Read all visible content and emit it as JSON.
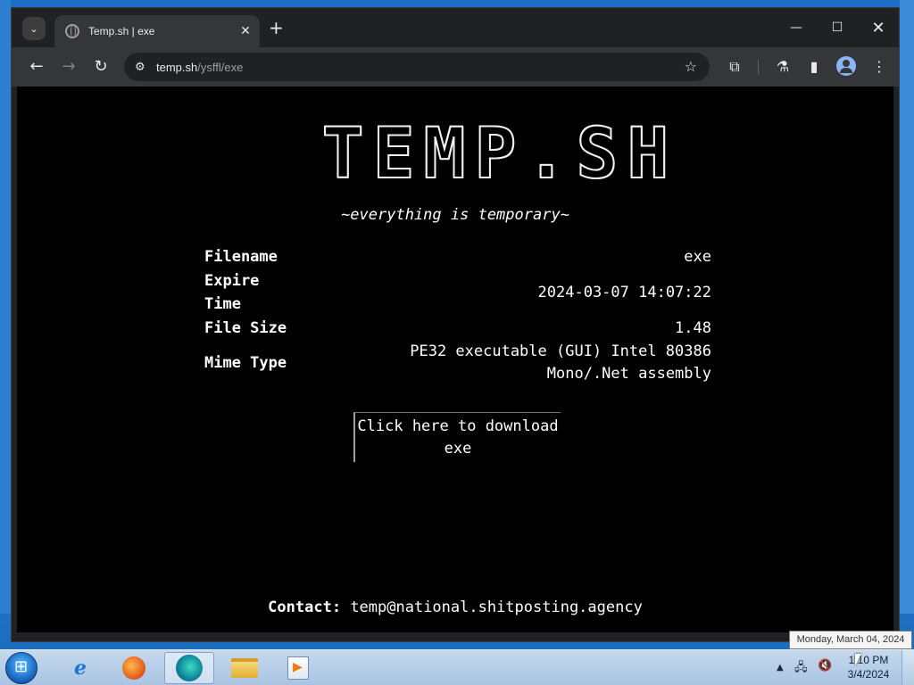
{
  "browser": {
    "tab_title": "Temp.sh | exe",
    "url_host": "temp.sh",
    "url_path": "/ysffl/exe"
  },
  "page": {
    "logo": "TEMP.SH",
    "tagline": "~everything is temporary~",
    "fields": {
      "filename_label": "Filename",
      "filename_value": "exe",
      "expire_label_1": "Expire",
      "expire_label_2": "Time",
      "expire_value": "2024-03-07 14:07:22",
      "filesize_label": "File Size",
      "filesize_value": "1.48",
      "mimetype_label": "Mime Type",
      "mimetype_value_1": "PE32 executable (GUI) Intel 80386",
      "mimetype_value_2": "Mono/.Net assembly"
    },
    "download_line_1": "Click here to download",
    "download_line_2": "exe",
    "contact_label": "Contact:",
    "contact_email": "temp@national.shitposting.agency"
  },
  "taskbar": {
    "tooltip": "Monday, March 04, 2024",
    "time": "1:10 PM",
    "date": "3/4/2024"
  },
  "icons": {
    "back": "←",
    "forward": "→",
    "reload": "↻",
    "star": "☆",
    "extensions": "⧉",
    "labs": "⚗",
    "sidepanel": "▮",
    "menu": "⋮",
    "tab_close": "✕",
    "new_tab": "+",
    "minimize": "—",
    "maximize": "☐",
    "close": "✕",
    "tab_search": "⌄",
    "tune": "⚙"
  }
}
